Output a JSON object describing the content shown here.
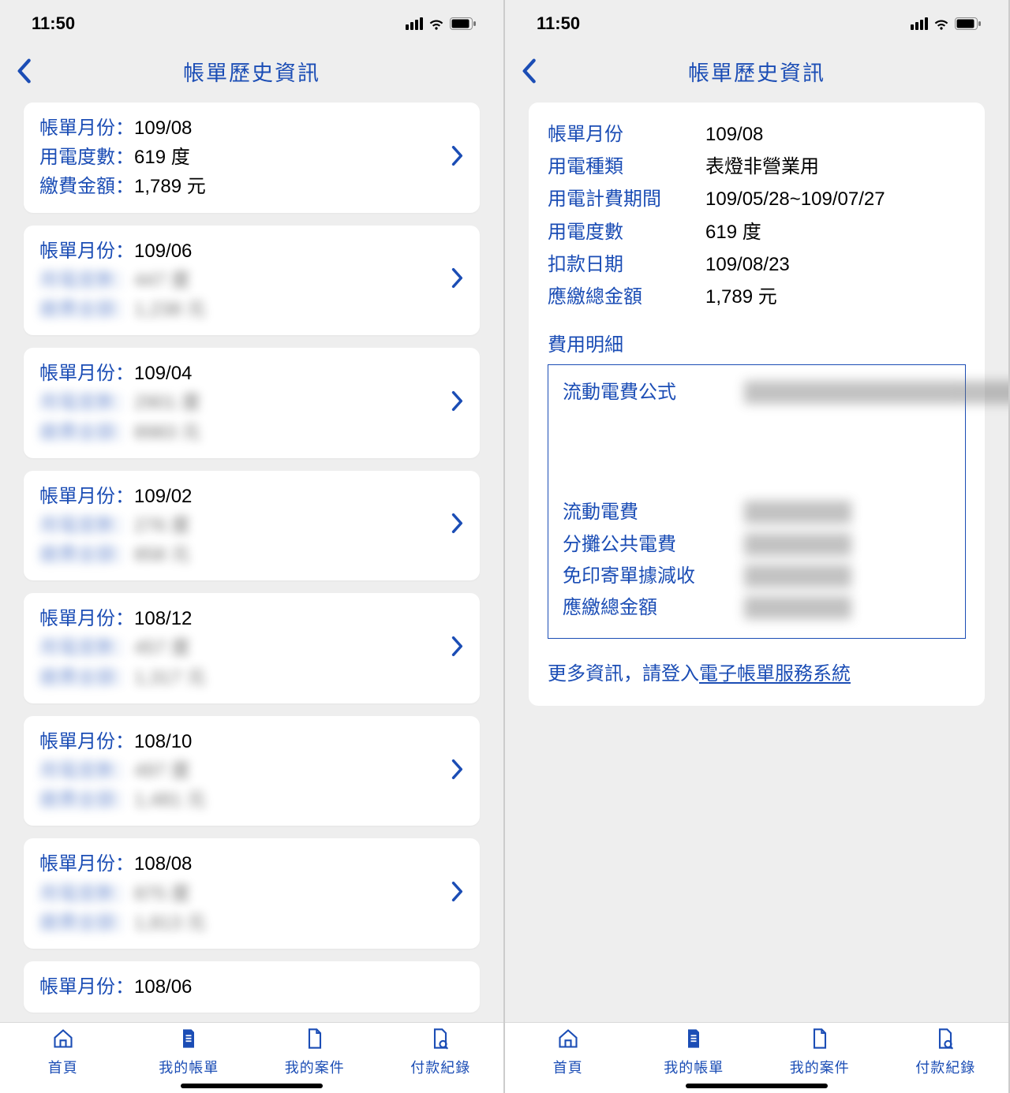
{
  "status": {
    "time": "11:50"
  },
  "header": {
    "title": "帳單歷史資訊"
  },
  "labels": {
    "bill_month": "帳單月份：",
    "usage": "用電度數：",
    "amount": "繳費金額："
  },
  "bills": [
    {
      "month": "109/08",
      "usage": "619 度",
      "amount": "1,789 元",
      "blur": false
    },
    {
      "month": "109/06",
      "usage": "447 度",
      "amount": "1,238 元",
      "blur": true
    },
    {
      "month": "109/04",
      "usage": "2901 度",
      "amount": "8983 元",
      "blur": true
    },
    {
      "month": "109/02",
      "usage": "276 度",
      "amount": "858 元",
      "blur": true
    },
    {
      "month": "108/12",
      "usage": "457 度",
      "amount": "1,317 元",
      "blur": true
    },
    {
      "month": "108/10",
      "usage": "497 度",
      "amount": "1,481 元",
      "blur": true
    },
    {
      "month": "108/08",
      "usage": "875 度",
      "amount": "1,813 元",
      "blur": true
    },
    {
      "month": "108/06",
      "usage": "",
      "amount": "",
      "blur": true
    }
  ],
  "detail": {
    "rows": [
      {
        "k": "帳單月份",
        "v": "109/08"
      },
      {
        "k": "用電種類",
        "v": "表燈非營業用"
      },
      {
        "k": "用電計費期間",
        "v": "109/05/28~109/07/27"
      },
      {
        "k": "用電度數",
        "v": "619 度"
      },
      {
        "k": "扣款日期",
        "v": "109/08/23"
      },
      {
        "k": "應繳總金額",
        "v": "1,789 元"
      }
    ],
    "section_title": "費用明細",
    "fee_rows": [
      {
        "k": "流動電費公式",
        "formula": true
      },
      {
        "k": "流動電費"
      },
      {
        "k": "分攤公共電費"
      },
      {
        "k": "免印寄單據減收"
      },
      {
        "k": "應繳總金額"
      }
    ],
    "more_info_prefix": "更多資訊，請登入",
    "more_info_link": "電子帳單服務系統"
  },
  "tabs": [
    {
      "id": "home",
      "label": "首頁"
    },
    {
      "id": "bills",
      "label": "我的帳單"
    },
    {
      "id": "cases",
      "label": "我的案件"
    },
    {
      "id": "payments",
      "label": "付款紀錄"
    }
  ]
}
